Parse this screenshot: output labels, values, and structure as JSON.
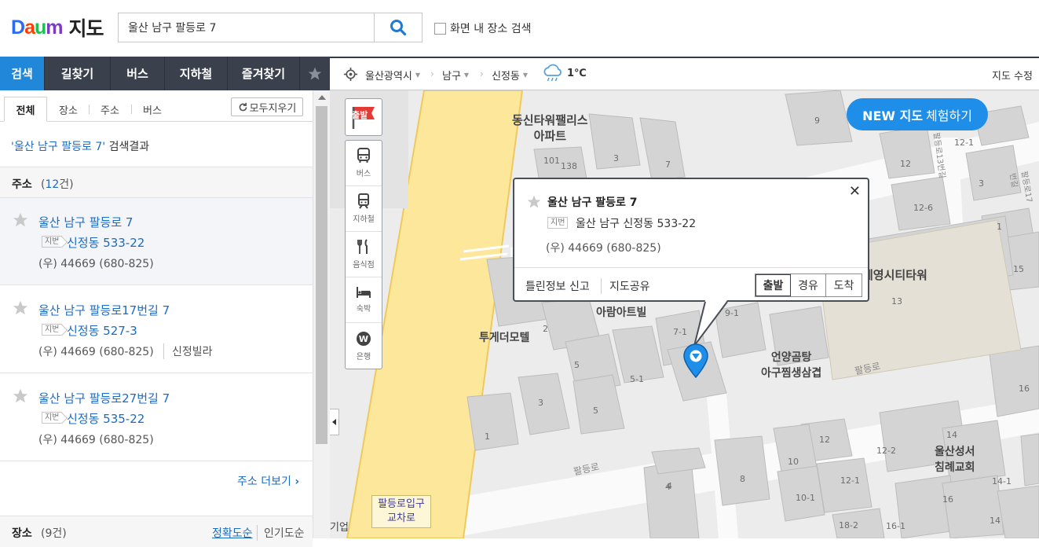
{
  "header": {
    "logo_daum": "Daum",
    "logo_map": "지도",
    "search_value": "울산 남구 팔등로 7",
    "area_search_label": "화면 내 장소 검색"
  },
  "nav_tabs": [
    "검색",
    "길찾기",
    "버스",
    "지하철",
    "즐겨찾기"
  ],
  "sub_tabs": [
    "전체",
    "장소",
    "주소",
    "버스"
  ],
  "clear_label": "모두지우기",
  "result_title": {
    "query": "'울산 남구 팔등로 7'",
    "suffix": " 검색결과"
  },
  "address_section": {
    "title": "주소",
    "count_prefix": "(",
    "count": "12",
    "count_suffix": "건)"
  },
  "results": [
    {
      "name": "울산 남구 팔등로 7",
      "jibun_tag": "지번",
      "jibun": "신정동 533-22",
      "zip": "(우) 44669 (680-825)",
      "extra": ""
    },
    {
      "name": "울산 남구 팔등로17번길 7",
      "jibun_tag": "지번",
      "jibun": "신정동 527-3",
      "zip": "(우) 44669 (680-825)",
      "extra": "신정빌라"
    },
    {
      "name": "울산 남구 팔등로27번길 7",
      "jibun_tag": "지번",
      "jibun": "신정동 535-22",
      "zip": "(우) 44669 (680-825)",
      "extra": ""
    }
  ],
  "more_address": "주소 더보기",
  "place_section": {
    "title": "장소",
    "count": "(9건)",
    "sort_accuracy": "정확도순",
    "sort_popular": "인기도순"
  },
  "map_bar": {
    "breadcrumb": [
      "울산광역시",
      "남구",
      "신정동"
    ],
    "temperature": "1℃",
    "edit_label": "지도 수정"
  },
  "toolbar": {
    "start": "출발",
    "items": [
      "버스",
      "지하철",
      "음식점",
      "숙박",
      "은행"
    ]
  },
  "new_map_button": {
    "bold": "NEW 지도",
    "rest": "체험하기"
  },
  "popup": {
    "title": "울산 남구 팔등로 7",
    "jibun_tag": "지번",
    "jibun": "울산 남구 신정동 533-22",
    "zip": "(우) 44669 (680-825)",
    "report": "틀린정보 신고",
    "share": "지도공유",
    "route_buttons": [
      "출발",
      "경유",
      "도착"
    ]
  },
  "map_labels": {
    "places": [
      "동신타워팰리스\n아파트",
      "투게더모텔",
      "아람아트빌",
      "계영시티타워",
      "언양곰탕\n아구찜생삼겹",
      "울산성서\n침례교회"
    ],
    "intersection": "팔등로입구\n교차로",
    "roads": [
      "팔등로",
      "팔등로",
      "팔등로17번길",
      "팔등로13번길"
    ],
    "edge_text": "기업",
    "building_numbers": [
      "9",
      "3",
      "7",
      "101",
      "138",
      "12-1",
      "12",
      "3",
      "12-6",
      "1",
      "15",
      "13",
      "4",
      "2",
      "7-1",
      "9-1",
      "5",
      "5-1",
      "3",
      "5",
      "1",
      "16",
      "14",
      "12",
      "12-2",
      "10",
      "12-1",
      "10-1",
      "16",
      "8",
      "4",
      "18-2",
      "16-1",
      "14-1",
      "14"
    ]
  },
  "colors": {
    "accent": "#2187d8",
    "nav_bg": "#3a414c",
    "road_main": "#fde79b",
    "link": "#1a6bc4"
  }
}
